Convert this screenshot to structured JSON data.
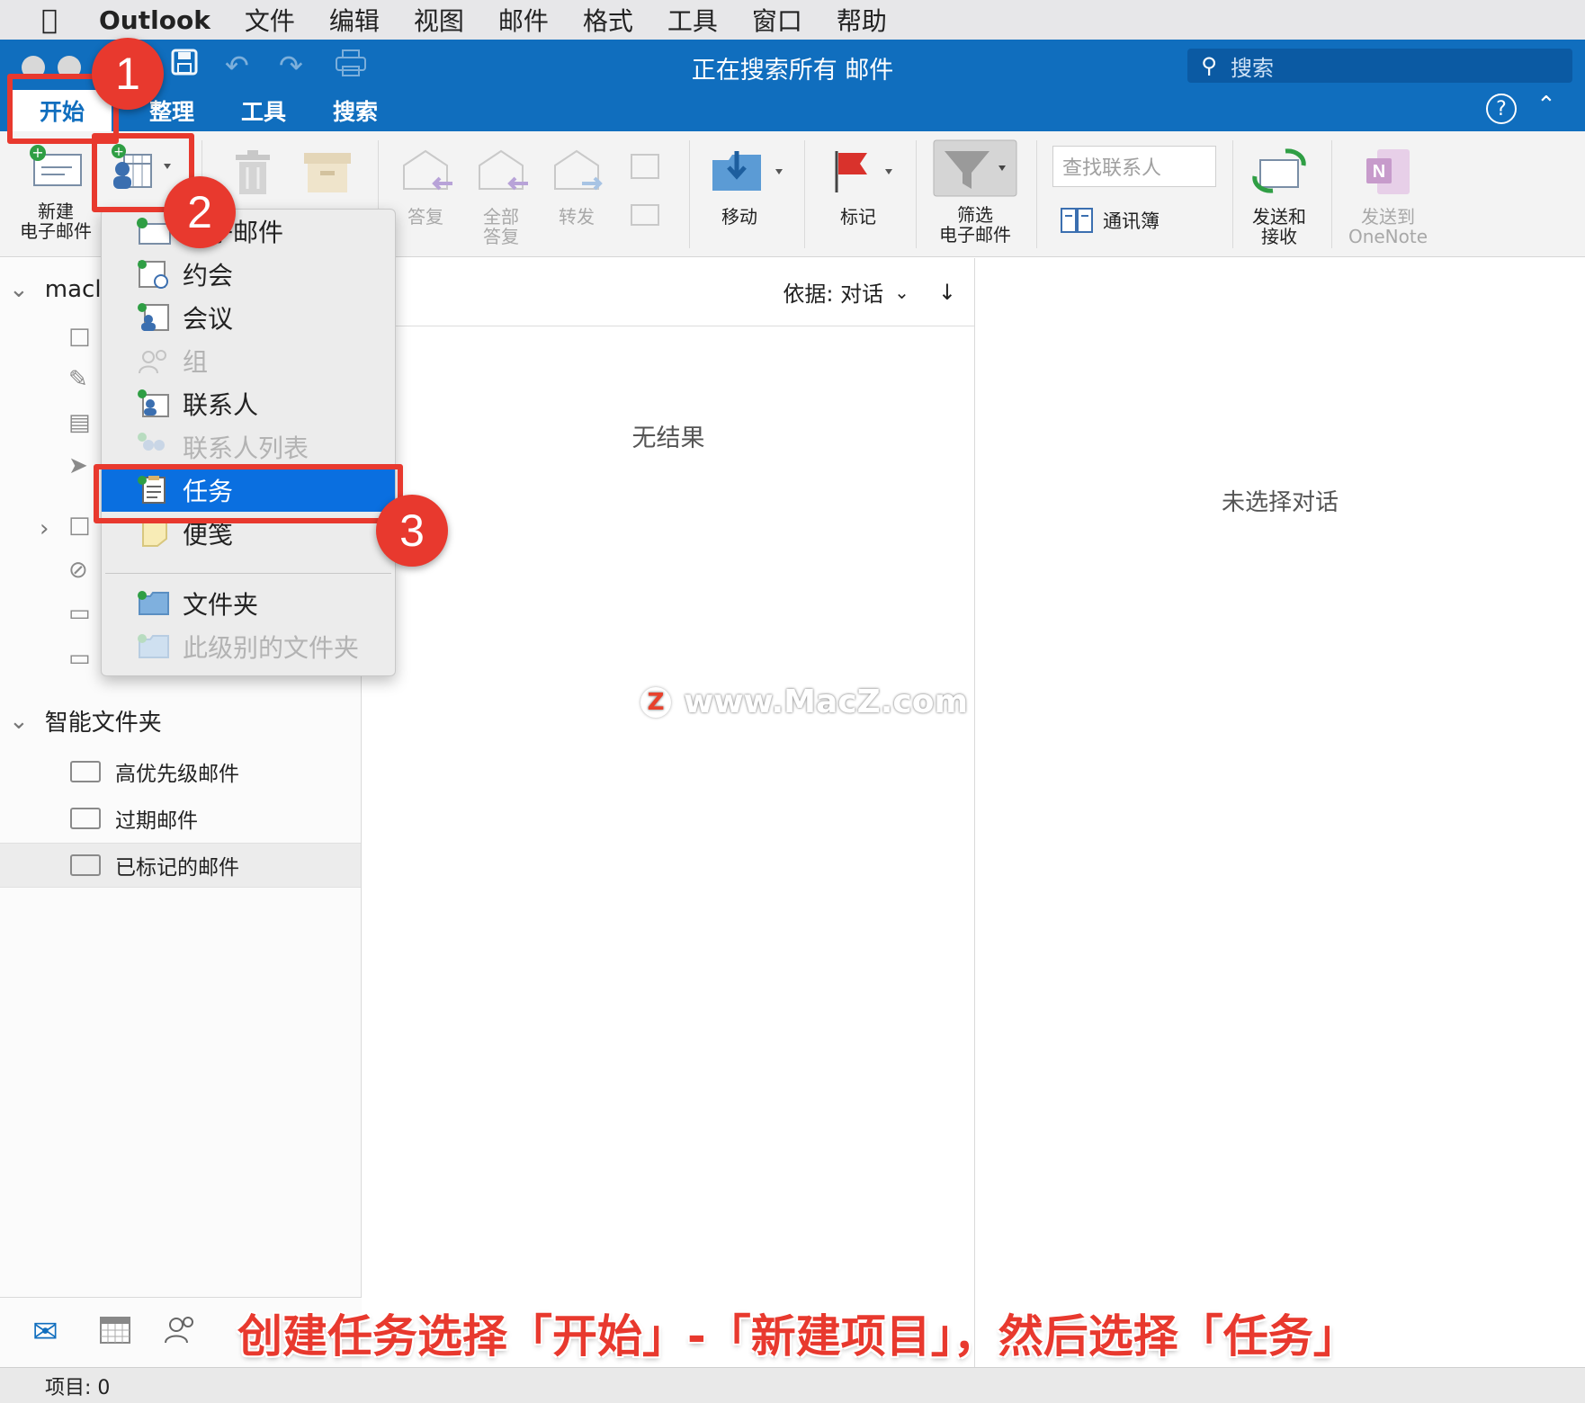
{
  "menubar": {
    "app": "Outlook",
    "items": [
      "文件",
      "编辑",
      "视图",
      "邮件",
      "格式",
      "工具",
      "窗口",
      "帮助"
    ]
  },
  "window": {
    "title": "正在搜索所有 邮件",
    "search_placeholder": "搜索"
  },
  "tabs": [
    "开始",
    "整理",
    "工具",
    "搜索"
  ],
  "ribbon": {
    "new_email": "新建\n电子邮件",
    "reply": "答复",
    "reply_all": "全部\n答复",
    "forward": "转发",
    "move": "移动",
    "flag": "标记",
    "filter": "筛选\n电子邮件",
    "find_contact_placeholder": "查找联系人",
    "address_book": "通讯簿",
    "send_receive": "发送和\n接收",
    "send_to_onenote": "发送到\nOneNote"
  },
  "dropdown": {
    "items": [
      {
        "label": "电子邮件",
        "enabled": true
      },
      {
        "label": "约会",
        "enabled": true
      },
      {
        "label": "会议",
        "enabled": true
      },
      {
        "label": "组",
        "enabled": false
      },
      {
        "label": "联系人",
        "enabled": true
      },
      {
        "label": "联系人列表",
        "enabled": false
      },
      {
        "label": "任务",
        "enabled": true,
        "highlighted": true
      },
      {
        "label": "便笺",
        "enabled": true
      },
      {
        "label": "文件夹",
        "enabled": true
      },
      {
        "label": "此级别的文件夹",
        "enabled": false
      }
    ]
  },
  "nav": {
    "account": "maclı",
    "smart_folders_title": "智能文件夹",
    "smart_folders": [
      "高优先级邮件",
      "过期邮件",
      "已标记的邮件"
    ]
  },
  "list": {
    "sort_label": "依据: 对话",
    "empty": "无结果"
  },
  "reading": {
    "empty": "未选择对话"
  },
  "watermark": "www.MacZ.com",
  "status": "项目: 0",
  "annotations": {
    "badges": [
      "1",
      "2",
      "3"
    ],
    "caption": "创建任务选择「开始」-「新建项目」，然后选择「任务」"
  },
  "colors": {
    "ribbon_blue": "#106ebe",
    "highlight": "#0a6fe0",
    "annotation_red": "#e8392e"
  }
}
